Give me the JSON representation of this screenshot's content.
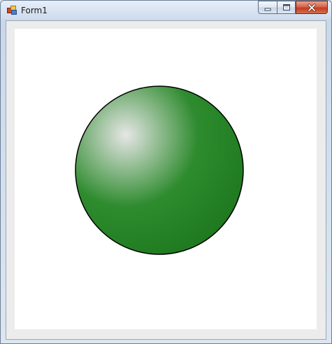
{
  "window": {
    "title": "Form1",
    "icon": "app-form-icon",
    "caption_buttons": [
      {
        "name": "minimize",
        "icon": "minimize-icon"
      },
      {
        "name": "maximize",
        "icon": "maximize-icon"
      },
      {
        "name": "close",
        "icon": "close-icon"
      }
    ]
  },
  "canvas": {
    "background": "#ffffff",
    "shape": {
      "type": "sphere",
      "fill_color": "#2e8b2e",
      "highlight_color": "#e6e6e6",
      "outline_color": "#000000"
    }
  }
}
